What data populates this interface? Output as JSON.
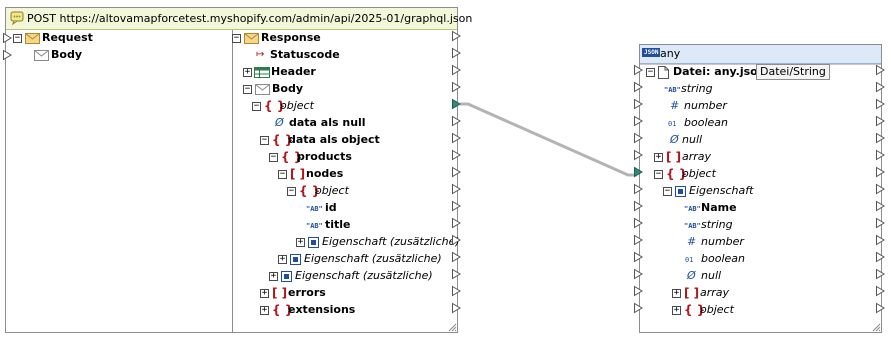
{
  "left_component": {
    "title": "POST https://altovamapforcetest.myshopify.com/admin/api/2025-01/graphql.json",
    "request": {
      "label": "Request",
      "body": "Body"
    },
    "response": {
      "label": "Response",
      "statuscode": "Statuscode",
      "header": "Header",
      "body": "Body",
      "object": "object",
      "data_null": "data als null",
      "data_object": "data als object",
      "products": "products",
      "nodes": "nodes",
      "nodes_object": "object",
      "id": "id",
      "title": "title",
      "eig1": "Eigenschaft (zusätzliche)",
      "eig2": "Eigenschaft (zusätzliche)",
      "eig3": "Eigenschaft (zusätzliche)",
      "errors": "errors",
      "extensions": "extensions"
    }
  },
  "right_component": {
    "title": "any",
    "json_badge": "JSON",
    "file_label": "Datei: any.json",
    "file_button": "Datei/String",
    "items": {
      "string": "string",
      "number": "number",
      "boolean": "boolean",
      "null": "null",
      "array": "array",
      "object": "object",
      "eigenschaft": "Eigenschaft",
      "name": "Name",
      "e_string": "string",
      "e_number": "number",
      "e_boolean": "boolean",
      "e_null": "null",
      "e_array": "array",
      "e_object": "object"
    }
  },
  "glyphs": {
    "ab": "\"AB\"",
    "hash": "#",
    "bool": "01",
    "null": "Ø",
    "brace": "{ }",
    "bracket": "[ ]",
    "plus": "+",
    "minus": "−",
    "arrow": "↦"
  },
  "colors": {
    "left_title_bg": "#f3f7d9",
    "right_title_bg": "#dde9f8",
    "connection": "#b4b4b4",
    "connected_port": "#2e8b7a",
    "brace": "#b0161c"
  }
}
